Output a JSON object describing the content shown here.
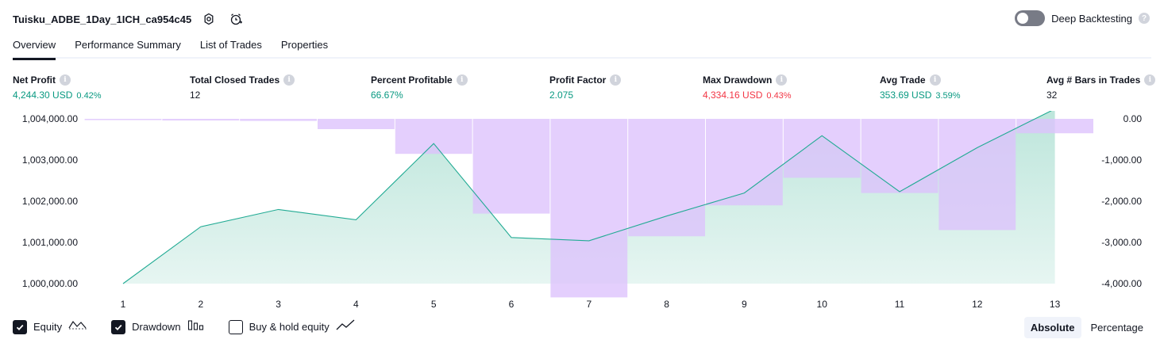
{
  "header": {
    "title": "Tuisku_ADBE_1Day_1ICH_ca954c45",
    "deep_backtesting_label": "Deep Backtesting"
  },
  "tabs": [
    {
      "label": "Overview",
      "active": true
    },
    {
      "label": "Performance Summary",
      "active": false
    },
    {
      "label": "List of Trades",
      "active": false
    },
    {
      "label": "Properties",
      "active": false
    }
  ],
  "metrics": [
    {
      "label": "Net Profit",
      "value": "4,244.30 USD",
      "pct": "0.42%",
      "tone": "pos"
    },
    {
      "label": "Total Closed Trades",
      "value": "12",
      "pct": "",
      "tone": "neutral"
    },
    {
      "label": "Percent Profitable",
      "value": "66.67%",
      "pct": "",
      "tone": "pos"
    },
    {
      "label": "Profit Factor",
      "value": "2.075",
      "pct": "",
      "tone": "pos"
    },
    {
      "label": "Max Drawdown",
      "value": "4,334.16 USD",
      "pct": "0.43%",
      "tone": "neg"
    },
    {
      "label": "Avg Trade",
      "value": "353.69 USD",
      "pct": "3.59%",
      "tone": "pos"
    },
    {
      "label": "Avg # Bars in Trades",
      "value": "32",
      "pct": "",
      "tone": "neutral"
    }
  ],
  "chart_data": {
    "type": "area",
    "x": [
      1,
      2,
      3,
      4,
      5,
      6,
      7,
      8,
      9,
      10,
      11,
      12,
      13
    ],
    "xticks": [
      "1",
      "2",
      "3",
      "4",
      "5",
      "6",
      "7",
      "8",
      "9",
      "10",
      "11",
      "12",
      "13"
    ],
    "series": [
      {
        "name": "Equity",
        "values": [
          1000000,
          1001380,
          1001800,
          1001550,
          1003400,
          1001120,
          1001040,
          1001640,
          1002200,
          1003590,
          1002230,
          1003300,
          1004240
        ]
      },
      {
        "name": "Drawdown",
        "values": [
          -30,
          -40,
          -50,
          -250,
          -850,
          -2300,
          -4334,
          -2850,
          -2100,
          -1430,
          -1800,
          -2700,
          -350
        ]
      }
    ],
    "left_axis": {
      "ylim": [
        1000000,
        1004000
      ],
      "ticks": [
        "1,000,000.00",
        "1,001,000.00",
        "1,002,000.00",
        "1,003,000.00",
        "1,004,000.00"
      ]
    },
    "right_axis": {
      "ylim": [
        -4000,
        0
      ],
      "ticks": [
        "-4,000.00",
        "-3,000.00",
        "-2,000.00",
        "-1,000.00",
        "0.00"
      ]
    },
    "colors": {
      "equity_line": "#22ab94",
      "equity_fill": "#b9e4d9",
      "drawdown_fill": "#dcc2fd",
      "text": "#131722"
    }
  },
  "legend": [
    {
      "label": "Equity",
      "checked": true,
      "icon": "equity-line-icon"
    },
    {
      "label": "Drawdown",
      "checked": true,
      "icon": "drawdown-bars-icon"
    },
    {
      "label": "Buy & hold equity",
      "checked": false,
      "icon": "buy-hold-line-icon"
    }
  ],
  "mode": {
    "absolute_label": "Absolute",
    "percentage_label": "Percentage",
    "active": "Absolute"
  }
}
